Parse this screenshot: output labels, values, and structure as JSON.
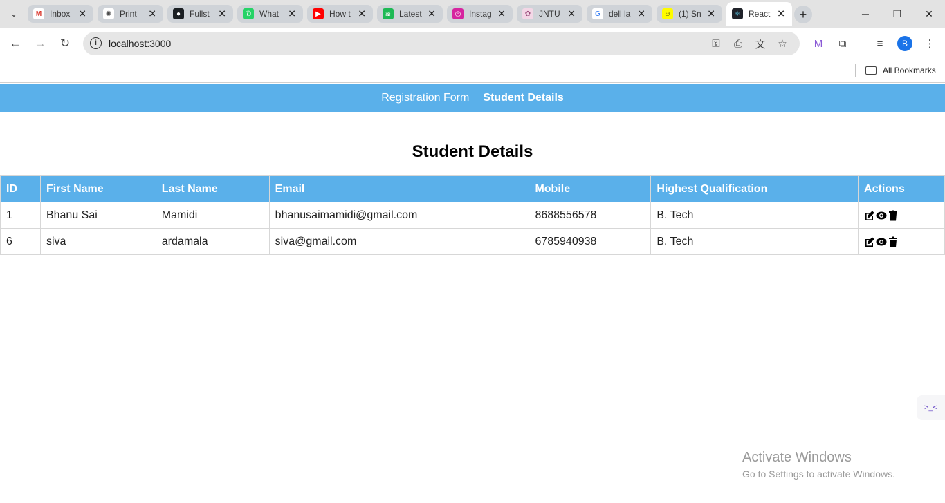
{
  "browser": {
    "tabs": [
      {
        "title": "Inbox",
        "icon": "gmail-icon",
        "color": "#ffffff",
        "glyph": "M",
        "glyph_color": "#d93025"
      },
      {
        "title": "Print",
        "icon": "chatgpt-icon",
        "color": "#ffffff",
        "glyph": "✺",
        "glyph_color": "#4a4a4a"
      },
      {
        "title": "Fullst",
        "icon": "github-icon",
        "color": "#1b1f23",
        "glyph": "●",
        "glyph_color": "#ffffff"
      },
      {
        "title": "What",
        "icon": "whatsapp-icon",
        "color": "#25d366",
        "glyph": "✆",
        "glyph_color": "#ffffff"
      },
      {
        "title": "How t",
        "icon": "youtube-icon",
        "color": "#ff0000",
        "glyph": "▶",
        "glyph_color": "#ffffff"
      },
      {
        "title": "Latest",
        "icon": "spotify-icon",
        "color": "#1db954",
        "glyph": "≋",
        "glyph_color": "#ffffff"
      },
      {
        "title": "Instag",
        "icon": "instagram-icon",
        "color": "#d6249f",
        "glyph": "◎",
        "glyph_color": "#ffffff"
      },
      {
        "title": "JNTU",
        "icon": "jntu-icon",
        "color": "#f3d7e6",
        "glyph": "✿",
        "glyph_color": "#9a4b7a"
      },
      {
        "title": "dell la",
        "icon": "google-icon",
        "color": "#ffffff",
        "glyph": "G",
        "glyph_color": "#4285f4"
      },
      {
        "title": "(1) Sn",
        "icon": "snapchat-icon",
        "color": "#fffc00",
        "glyph": "☺",
        "glyph_color": "#222222"
      },
      {
        "title": "React",
        "icon": "react-icon",
        "color": "#20232a",
        "glyph": "⚛",
        "glyph_color": "#61dafb"
      }
    ],
    "url": "localhost:3000",
    "bookmarks_label": "All Bookmarks",
    "profile_initial": "B"
  },
  "nav": {
    "registration": "Registration Form",
    "details": "Student Details"
  },
  "page": {
    "title": "Student Details"
  },
  "table": {
    "headers": [
      "ID",
      "First Name",
      "Last Name",
      "Email",
      "Mobile",
      "Highest Qualification",
      "Actions"
    ],
    "rows": [
      {
        "id": "1",
        "first": "Bhanu Sai",
        "last": "Mamidi",
        "email": "bhanusaimamidi@gmail.com",
        "mobile": "8688556578",
        "qual": "B. Tech"
      },
      {
        "id": "6",
        "first": "siva",
        "last": "ardamala",
        "email": "siva@gmail.com",
        "mobile": "6785940938",
        "qual": "B. Tech"
      }
    ]
  },
  "watermark": {
    "line1": "Activate Windows",
    "line2": "Go to Settings to activate Windows."
  },
  "colors": {
    "accent": "#5ab0ea"
  }
}
